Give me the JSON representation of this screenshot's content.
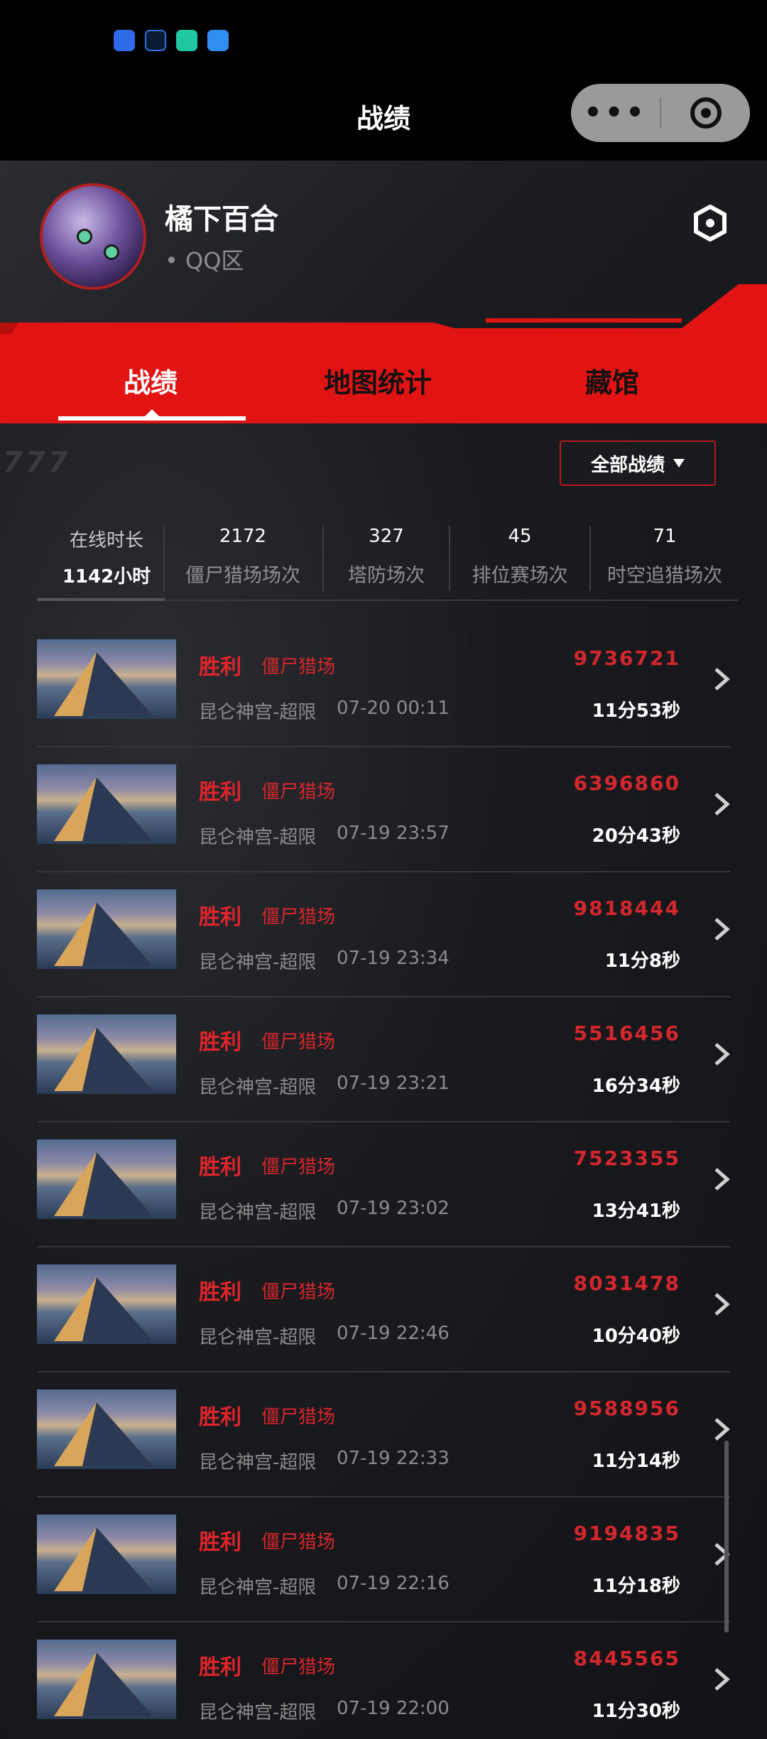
{
  "nav": {
    "title": "战绩",
    "more_label": "•••"
  },
  "profile": {
    "name": "橘下百合",
    "server": "• QQ区"
  },
  "tabs": [
    {
      "label": "战绩",
      "active": true
    },
    {
      "label": "地图统计",
      "active": false
    },
    {
      "label": "藏馆",
      "active": false
    }
  ],
  "filter": {
    "label": "全部战绩"
  },
  "stats": [
    {
      "label": "在线时长",
      "value": "1142小时"
    },
    {
      "label": "僵尸猎场场次",
      "value": "2172"
    },
    {
      "label": "塔防场次",
      "value": "327"
    },
    {
      "label": "排位赛场次",
      "value": "45"
    },
    {
      "label": "时空追猎场次",
      "value": "71"
    }
  ],
  "matches": [
    {
      "result": "胜利",
      "mode": "僵尸猎场",
      "score": "9736721",
      "map": "昆仑神宫-超限",
      "time": "07-20 00:11",
      "duration": "11分53秒"
    },
    {
      "result": "胜利",
      "mode": "僵尸猎场",
      "score": "6396860",
      "map": "昆仑神宫-超限",
      "time": "07-19 23:57",
      "duration": "20分43秒"
    },
    {
      "result": "胜利",
      "mode": "僵尸猎场",
      "score": "9818444",
      "map": "昆仑神宫-超限",
      "time": "07-19 23:34",
      "duration": "11分8秒"
    },
    {
      "result": "胜利",
      "mode": "僵尸猎场",
      "score": "5516456",
      "map": "昆仑神宫-超限",
      "time": "07-19 23:21",
      "duration": "16分34秒"
    },
    {
      "result": "胜利",
      "mode": "僵尸猎场",
      "score": "7523355",
      "map": "昆仑神宫-超限",
      "time": "07-19 23:02",
      "duration": "13分41秒"
    },
    {
      "result": "胜利",
      "mode": "僵尸猎场",
      "score": "8031478",
      "map": "昆仑神宫-超限",
      "time": "07-19 22:46",
      "duration": "10分40秒"
    },
    {
      "result": "胜利",
      "mode": "僵尸猎场",
      "score": "9588956",
      "map": "昆仑神宫-超限",
      "time": "07-19 22:33",
      "duration": "11分14秒"
    },
    {
      "result": "胜利",
      "mode": "僵尸猎场",
      "score": "9194835",
      "map": "昆仑神宫-超限",
      "time": "07-19 22:16",
      "duration": "11分18秒"
    },
    {
      "result": "胜利",
      "mode": "僵尸猎场",
      "score": "8445565",
      "map": "昆仑神宫-超限",
      "time": "07-19 22:00",
      "duration": "11分30秒"
    }
  ],
  "colors": {
    "accent": "#d4262d",
    "band": "#e11313",
    "background": "#1a1b1f"
  }
}
